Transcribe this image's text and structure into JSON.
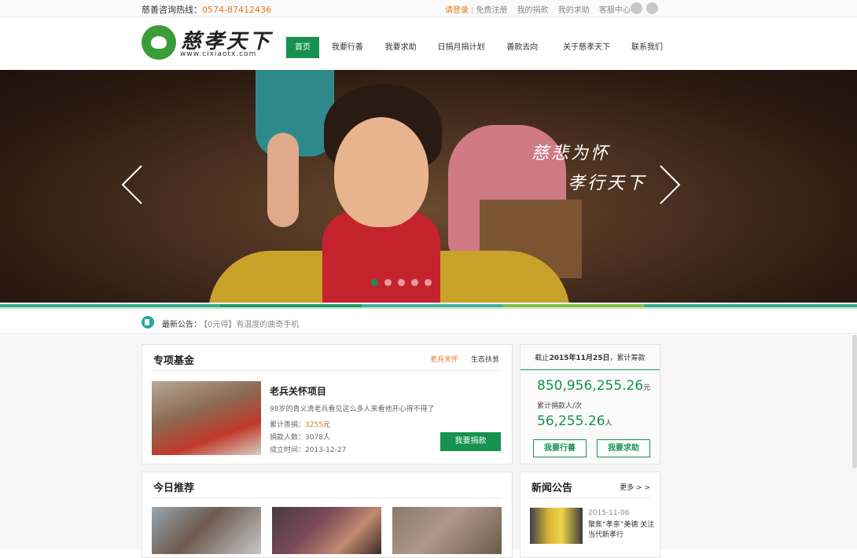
{
  "topbar": {
    "hotline_label": "慈善咨询热线：",
    "hotline_number": "0574-87412436",
    "links": [
      "请登录",
      "免费注册",
      "我的捐款",
      "我的求助",
      "客服中心"
    ]
  },
  "logo": {
    "name": "慈孝天下",
    "url": "www.cixiaotx.com"
  },
  "nav": [
    "首页",
    "我要行善",
    "我要求助",
    "日捐月捐计划",
    "善款去向",
    "关于慈孝天下",
    "联系我们"
  ],
  "banner": {
    "slogan_line1": "慈悲为怀",
    "slogan_line2": "孝行天下",
    "slide_count": 5,
    "active_slide": 1
  },
  "notice": {
    "label": "最新公告：",
    "text": "【0元得】有温度的曲奇手机"
  },
  "fund": {
    "title": "专项基金",
    "tabs": [
      "老兵关怀",
      "生态扶贫"
    ],
    "project_name": "老兵关怀项目",
    "project_desc": "98岁的青义清老兵看见这么多人来看他开心得不得了",
    "raised_label": "累计善捐：",
    "raised_value": "3255",
    "raised_unit": "元",
    "donors": "捐款人数：3078人",
    "established": "成立时间：2013-12-27",
    "donate_button": "我要捐款"
  },
  "stats": {
    "header_prefix": "截止",
    "header_date": "2015年11月25日",
    "header_suffix": "，累计筹款",
    "total_amount": "850,956,255.26",
    "total_unit": "元",
    "donors_label": "累计捐款人/次",
    "donors_count": "56,255.26",
    "donors_unit": "人",
    "btn_give": "我要行善",
    "btn_help": "我要求助"
  },
  "today": {
    "title": "今日推荐"
  },
  "news": {
    "title": "新闻公告",
    "more": "更多 > >",
    "date": "2015-11-06",
    "headline": "聚焦“孝亲”美德 关注当代新孝行"
  },
  "colors": {
    "brand_green": "#16914f",
    "accent_orange": "#e3781f"
  }
}
